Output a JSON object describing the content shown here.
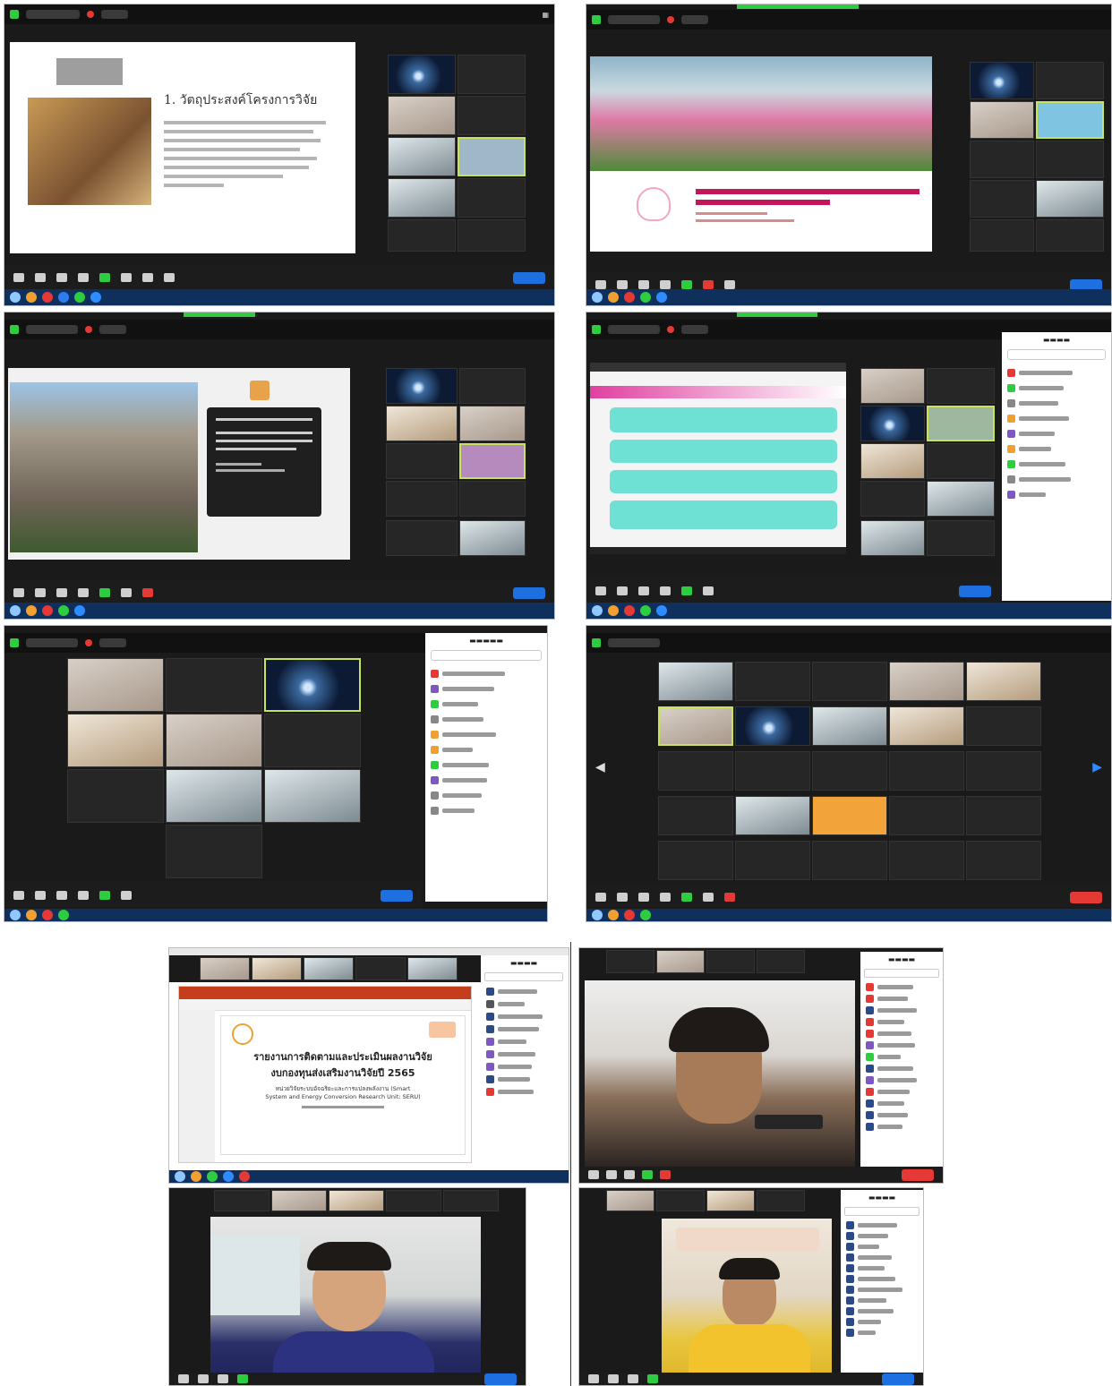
{
  "collage": {
    "s1": {
      "slide_heading": "1. วัตถุประสงค์โครงการวิจัย"
    },
    "s7": {
      "slide_title_line1": "รายงานการติดตามและประเมินผลงานวิจัย",
      "slide_title_line2": "งบกองทุนส่งเสริมงานวิจัยปี 2565",
      "slide_unit_line1": "หน่วยวิจัยระบบอัจฉริยะและการแปลงพลังงาน (Smart",
      "slide_unit_line2": "System and Energy Conversion Research Unit: SERU)"
    }
  },
  "colors": {
    "zoom_bg": "#1a1a1a",
    "zoom_green": "#2ecc40",
    "zoom_blue": "#1e6fe0",
    "zoom_red": "#e53935",
    "slide_teal": "#66d9cf",
    "slide_pink": "#d81b60",
    "taskbar": "#0f2f5c"
  },
  "icons": [
    "security-shield-icon",
    "record-icon",
    "microphone-icon",
    "video-icon",
    "participants-icon",
    "chat-icon",
    "share-screen-icon",
    "reactions-icon",
    "windows-start-icon",
    "next-page-arrow-icon",
    "prev-page-arrow-icon"
  ]
}
